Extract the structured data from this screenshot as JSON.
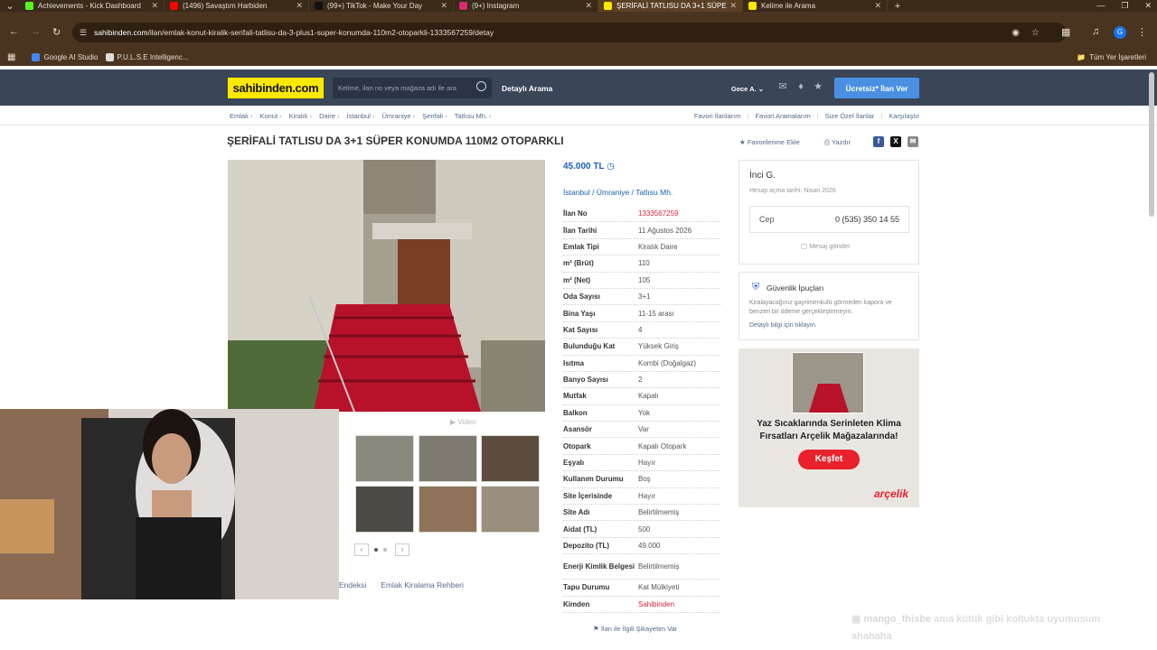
{
  "browser": {
    "tabs": [
      {
        "title": "Achievements - Kick Dashboard",
        "color": "#53fc18",
        "active": false
      },
      {
        "title": "(1496) Savaştım Harbiden",
        "color": "#ff0000",
        "active": false
      },
      {
        "title": "(99+) TikTok - Make Your Day",
        "color": "#111111",
        "active": false
      },
      {
        "title": "(9+) Instagram",
        "color": "#d62976",
        "active": false
      },
      {
        "title": "ŞERİFALİ TATLISU DA 3+1 SÜPE",
        "color": "#ffe800",
        "active": true
      },
      {
        "title": "Kelime ile Arama",
        "color": "#ffe800",
        "active": false
      }
    ],
    "new_tab": "+",
    "url_host": "sahibinden.com",
    "url_path": "/ilan/emlak-konut-kiralik-serifali-tatlisu-da-3-plus1-super-konumda-110m2-otoparkli-1333567259/detay",
    "bookmarks": [
      {
        "label": "Google AI Studio",
        "color": "#4285f4"
      },
      {
        "label": "P.U.L.S.E Intelligenc...",
        "color": "#dddddd"
      }
    ],
    "all_bookmarks": "Tüm Yer İşaretleri",
    "profile_initial": "G"
  },
  "site": {
    "logo": "sahibinden.com",
    "search_placeholder": "Kelime, ilan no veya mağaza adı ile ara",
    "detailed_search": "Detaylı Arama",
    "user": "Gece A.",
    "post_ad": "Ücretsiz* İlan Ver",
    "brand_color": "#ffe800"
  },
  "breadcrumbs": [
    "Emlak",
    "Konut",
    "Kiralık",
    "Daire",
    "İstanbul",
    "Ümraniye",
    "Şerifali",
    "Tatlısu Mh."
  ],
  "right_links": [
    "Favori İlanlarım",
    "Favori Aramalarım",
    "Size Özel İlanlar",
    "Karşılaştır"
  ],
  "listing": {
    "title": "ŞERİFALİ TATLISU DA 3+1 SÜPER KONUMDA 110M2 OTOPARKLI",
    "add_favorite": "Favorilerime Ekle",
    "print": "Yazdır",
    "price": "45.000 TL",
    "location": [
      "İstanbul",
      "Ümraniye",
      "Tatlısu Mh."
    ],
    "video_label": "Video",
    "details": [
      {
        "key": "İlan No",
        "value": "1333567259",
        "red": true
      },
      {
        "key": "İlan Tarihi",
        "value": "11 Ağustos 2026"
      },
      {
        "key": "Emlak Tipi",
        "value": "Kiralık Daire"
      },
      {
        "key": "m² (Brüt)",
        "value": "110"
      },
      {
        "key": "m² (Net)",
        "value": "105"
      },
      {
        "key": "Oda Sayısı",
        "value": "3+1"
      },
      {
        "key": "Bina Yaşı",
        "value": "11-15 arası"
      },
      {
        "key": "Kat Sayısı",
        "value": "4"
      },
      {
        "key": "Bulunduğu Kat",
        "value": "Yüksek Giriş"
      },
      {
        "key": "Isıtma",
        "value": "Kombi (Doğalgaz)"
      },
      {
        "key": "Banyo Sayısı",
        "value": "2"
      },
      {
        "key": "Mutfak",
        "value": "Kapalı"
      },
      {
        "key": "Balkon",
        "value": "Yok"
      },
      {
        "key": "Asansör",
        "value": "Var"
      },
      {
        "key": "Otopark",
        "value": "Kapalı Otopark"
      },
      {
        "key": "Eşyalı",
        "value": "Hayır"
      },
      {
        "key": "Kullanım Durumu",
        "value": "Boş"
      },
      {
        "key": "Site İçerisinde",
        "value": "Hayır"
      },
      {
        "key": "Site Adı",
        "value": "Belirtilmemiş"
      },
      {
        "key": "Aidat (TL)",
        "value": "500"
      },
      {
        "key": "Depozito (TL)",
        "value": "49.000"
      },
      {
        "key": "Enerji Kimlik Belgesi",
        "value": "Belirtilmemiş",
        "tall": true
      },
      {
        "key": "Tapu Durumu",
        "value": "Kat Mülkiyeti"
      },
      {
        "key": "Kimden",
        "value": "Sahibinden",
        "red": true
      }
    ],
    "complain": "İlan ile İlgili Şikayetim Var",
    "below_links": [
      "Endeksi",
      "Emlak Kiralama Rehberi"
    ]
  },
  "seller": {
    "name": "İnci G.",
    "since": "Hesap açma tarihi: Nisan 2026",
    "phone_label": "Cep",
    "phone": "0 (535) 350 14 55",
    "message": "Mesaj gönder"
  },
  "security": {
    "title": "Güvenlik İpuçları",
    "text": "Kiralayacağınız gayrimenkulü görmeden kapora ve benzeri bir ödeme gerçekleştirmeyin.",
    "link": "Detaylı bilgi için tıklayın."
  },
  "ad": {
    "text": "Yaz Sıcaklarında Serinleten Klima Fırsatları Arçelik Mağazalarında!",
    "button": "Keşfet",
    "brand": "arçelik"
  },
  "chat": {
    "user": "mango_thisbe",
    "message": "ama kütük gibi koltukta uyumusum ahahaha"
  }
}
